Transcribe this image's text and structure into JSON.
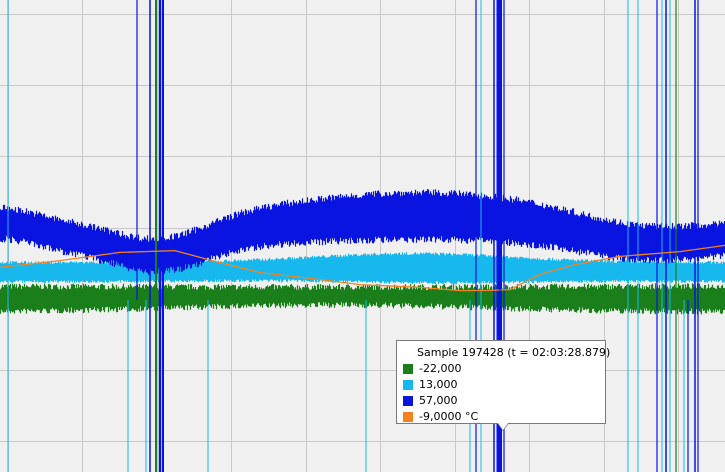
{
  "tooltip": {
    "title": "Sample 197428 (t = 02:03:28.879)",
    "rows": [
      {
        "label": "-22,000",
        "color": "#1a7f1a"
      },
      {
        "label": "13,000",
        "color": "#17b8ee"
      },
      {
        "label": "57,000",
        "color": "#0a14e0"
      },
      {
        "label": "-9,0000 °C",
        "color": "#f58220"
      }
    ]
  },
  "colors": {
    "background": "#f0f0f0",
    "grid": "#c8c8c8",
    "series_green": "#1a7f1a",
    "series_cyan": "#17b8ee",
    "series_blue": "#0a14e0",
    "series_orange": "#f58220"
  }
}
